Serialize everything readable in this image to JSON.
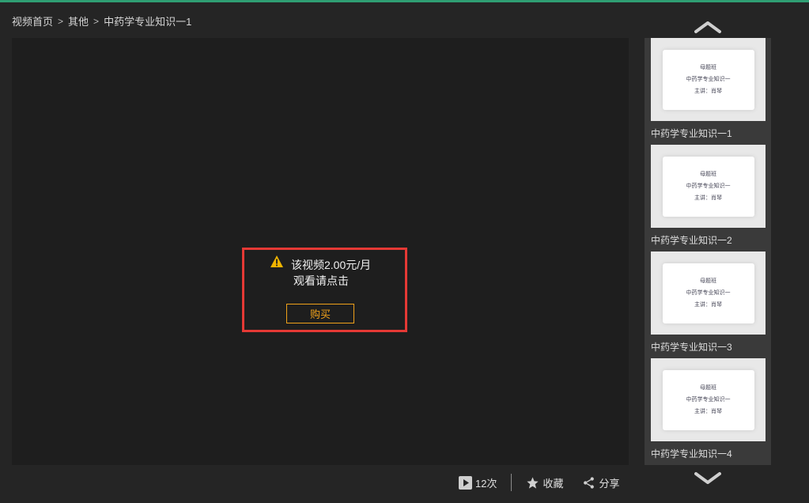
{
  "breadcrumb": [
    {
      "label": "视频首页"
    },
    {
      "label": "其他"
    },
    {
      "label": "中药学专业知识一1"
    }
  ],
  "breadcrumb_separator": ">",
  "paywall": {
    "line1": "该视频2.00元/月",
    "line2": "观看请点击",
    "buy_label": "购买",
    "warning_icon": "warning-triangle-icon",
    "accent_color": "#f0a11a",
    "highlight_color": "#e53935"
  },
  "playlist": {
    "items": [
      {
        "card_line1": "母题班",
        "card_line2": "中药学专业知识一",
        "card_line3": "主讲：肖琴",
        "title": "中药学专业知识一1"
      },
      {
        "card_line1": "母题班",
        "card_line2": "中药学专业知识一",
        "card_line3": "主讲：肖琴",
        "title": "中药学专业知识一2"
      },
      {
        "card_line1": "母题班",
        "card_line2": "中药学专业知识一",
        "card_line3": "主讲：肖琴",
        "title": "中药学专业知识一3"
      },
      {
        "card_line1": "母题班",
        "card_line2": "中药学专业知识一",
        "card_line3": "主讲：肖琴",
        "title": "中药学专业知识一4"
      }
    ]
  },
  "bottom": {
    "play_count": "12次",
    "favorite_label": "收藏",
    "share_label": "分享"
  },
  "colors": {
    "top_strip": "#2f9e73",
    "background": "#252525",
    "player_bg": "#1e1e1e",
    "playlist_bg": "#3a3a3a"
  }
}
